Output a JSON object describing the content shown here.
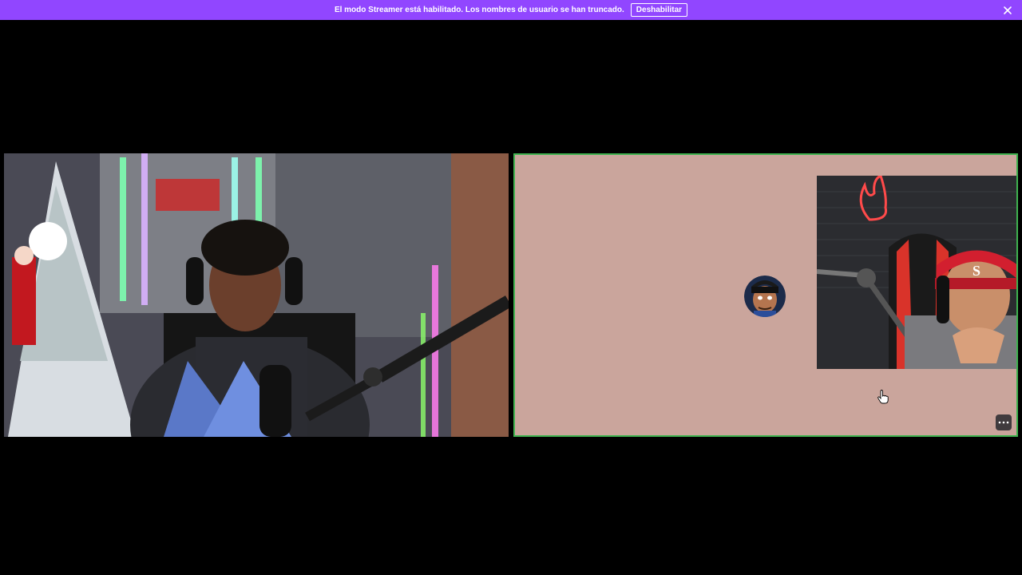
{
  "banner": {
    "message": "El modo Streamer está habilitado. Los nombres de usuario se han truncado.",
    "disable_label": "Deshabilitar",
    "close_icon": "close-icon"
  },
  "colors": {
    "banner_bg": "#9146ff",
    "speaking_border": "#3fb24f",
    "right_tile_bg": "#caa59c",
    "background": "#000000"
  },
  "participants": [
    {
      "id": "left-video",
      "kind": "camera-video"
    },
    {
      "id": "right-screen",
      "kind": "avatar-with-pip-video",
      "speaking": true
    }
  ],
  "controls": {
    "more_icon": "more-options-icon"
  }
}
